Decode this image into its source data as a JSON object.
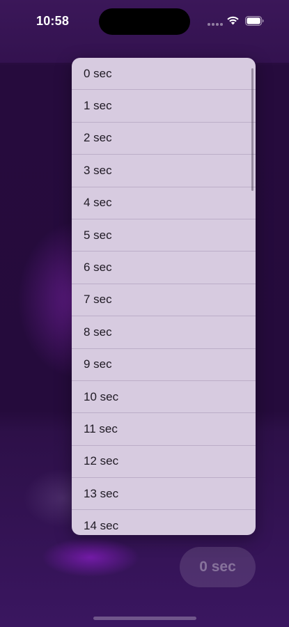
{
  "status_bar": {
    "time": "10:58",
    "icons": [
      "signal-dots-icon",
      "wifi-icon",
      "battery-icon"
    ]
  },
  "dropdown": {
    "options": [
      "0 sec",
      "1 sec",
      "2 sec",
      "3 sec",
      "4 sec",
      "5 sec",
      "6 sec",
      "7 sec",
      "8 sec",
      "9 sec",
      "10 sec",
      "11 sec",
      "12 sec",
      "13 sec",
      "14 sec"
    ]
  },
  "selected_button": {
    "label": "0 sec"
  },
  "colors": {
    "background": "#2c0f46",
    "dropdown_bg": "#d7cbe0",
    "option_text": "#1f1a24"
  }
}
